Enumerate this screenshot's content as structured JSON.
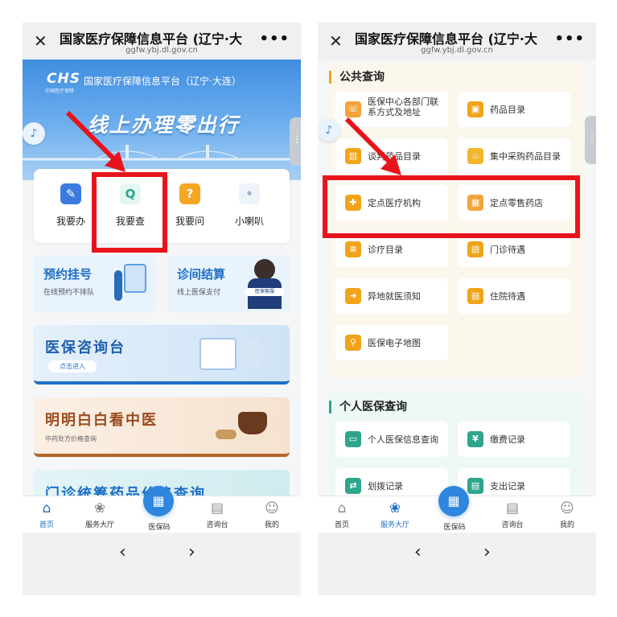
{
  "window": {
    "close": "✕",
    "title": "国家医疗保障信息平台 (辽宁·大",
    "url": "ggfw.ybj.dl.gov.cn",
    "more": "•••"
  },
  "left": {
    "banner": {
      "logo": "CHS",
      "logo_sub": "中国医疗保障",
      "org": "国家医疗保障信息平台（辽宁·大连）",
      "slogan": "线上办理零出行"
    },
    "quick": [
      "我要办",
      "我要查",
      "我要问",
      "小喇叭"
    ],
    "cards": [
      {
        "title": "预约挂号",
        "sub": "在线预约不排队"
      },
      {
        "title": "诊间结算",
        "sub": "线上医保支付"
      }
    ],
    "avatar_badge": "医保客服",
    "promos": [
      {
        "title": "医保咨询台",
        "button": "点击进入"
      },
      {
        "title": "明明白白看中医",
        "sub": "中药处方价格查询"
      },
      {
        "title": "门诊统筹药品价格查询"
      }
    ]
  },
  "right": {
    "public_title": "公共查询",
    "public_items": [
      "医保中心各部门联系方式及地址",
      "药品目录",
      "谈判药品目录",
      "集中采购药品目录",
      "定点医疗机构",
      "定点零售药店",
      "诊疗目录",
      "门诊待遇",
      "异地就医须知",
      "住院待遇",
      "医保电子地图"
    ],
    "personal_title": "个人医保查询",
    "personal_items": [
      "个人医保信息查询",
      "缴费记录",
      "划拨记录",
      "支出记录"
    ]
  },
  "tabbar": {
    "home": "首页",
    "service": "服务大厅",
    "code": "医保码",
    "consult": "咨询台",
    "mine": "我的"
  },
  "nav": {
    "back": "‹",
    "forward": "›"
  },
  "colors": {
    "highlight": "#e8141c",
    "brand": "#1f6fc8",
    "accent_orange": "#f0a419"
  }
}
